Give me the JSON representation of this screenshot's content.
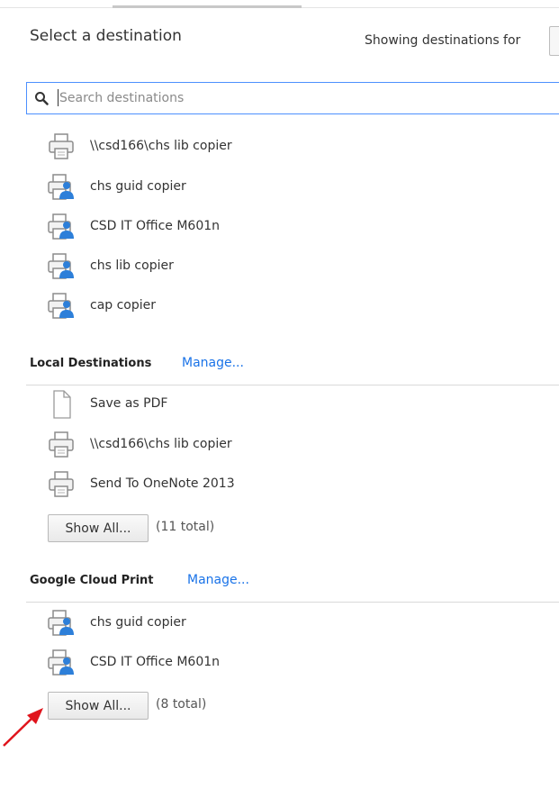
{
  "header": {
    "title": "Select a destination",
    "showing_label": "Showing destinations for"
  },
  "search": {
    "placeholder": "Search destinations"
  },
  "recent_destinations": [
    {
      "label": "\\\\csd166\\chs lib copier",
      "icon": "printer-icon"
    },
    {
      "label": "chs guid copier",
      "icon": "cloud-printer-icon"
    },
    {
      "label": "CSD IT Office M601n",
      "icon": "cloud-printer-icon"
    },
    {
      "label": "chs lib copier",
      "icon": "cloud-printer-icon"
    },
    {
      "label": "cap copier",
      "icon": "cloud-printer-icon"
    }
  ],
  "local_section": {
    "title": "Local Destinations",
    "manage_label": "Manage...",
    "items": [
      {
        "label": "Save as PDF",
        "icon": "pdf-document-icon"
      },
      {
        "label": "\\\\csd166\\chs lib copier",
        "icon": "printer-icon"
      },
      {
        "label": "Send To OneNote 2013",
        "icon": "printer-icon"
      }
    ],
    "show_all_label": "Show All...",
    "total_label": "(11 total)"
  },
  "cloud_section": {
    "title": "Google Cloud Print",
    "manage_label": "Manage...",
    "items": [
      {
        "label": "chs guid copier",
        "icon": "cloud-printer-icon"
      },
      {
        "label": "CSD IT Office M601n",
        "icon": "cloud-printer-icon"
      }
    ],
    "show_all_label": "Show All...",
    "total_label": "(8 total)"
  },
  "colors": {
    "link": "#1a73e8",
    "search_border": "#4d90fe",
    "annotation_arrow": "#e0141c"
  }
}
